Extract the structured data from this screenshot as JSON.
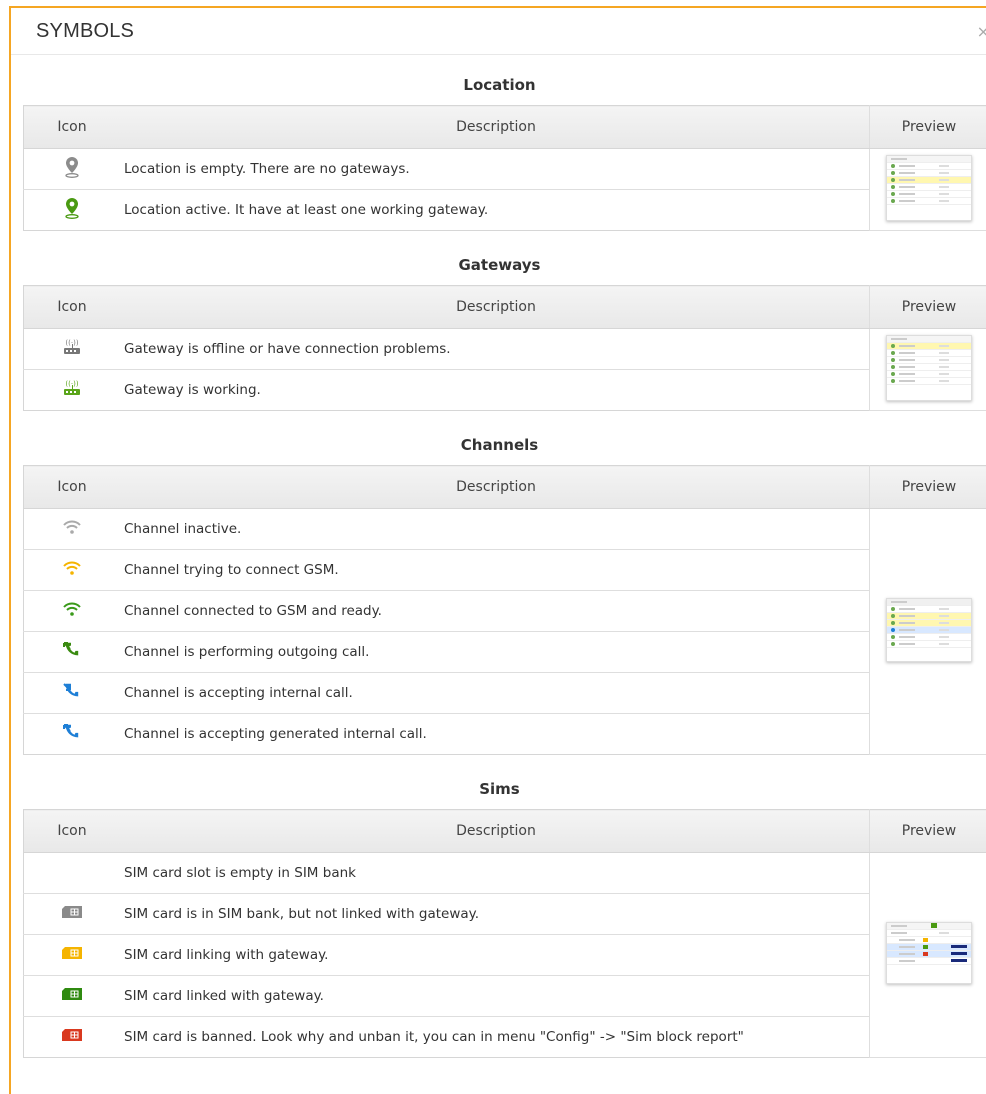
{
  "dialog": {
    "title": "SYMBOLS",
    "close": "×"
  },
  "columns": {
    "icon": "Icon",
    "description": "Description",
    "preview": "Preview"
  },
  "sections": {
    "location": {
      "title": "Location",
      "rows": [
        {
          "icon": "location-pin-gray-icon",
          "description": "Location is empty. There are no gateways."
        },
        {
          "icon": "location-pin-green-icon",
          "description": "Location active. It have at least one working gateway."
        }
      ]
    },
    "gateways": {
      "title": "Gateways",
      "rows": [
        {
          "icon": "gateway-gray-icon",
          "description": "Gateway is offline or have connection problems."
        },
        {
          "icon": "gateway-green-icon",
          "description": "Gateway is working."
        }
      ]
    },
    "channels": {
      "title": "Channels",
      "rows": [
        {
          "icon": "wifi-gray-icon",
          "description": "Channel inactive."
        },
        {
          "icon": "wifi-orange-icon",
          "description": "Channel trying to connect GSM."
        },
        {
          "icon": "wifi-green-icon",
          "description": "Channel connected to GSM and ready."
        },
        {
          "icon": "phone-outgoing-green-icon",
          "description": "Channel is performing outgoing call."
        },
        {
          "icon": "phone-incoming-blue-icon",
          "description": "Channel is accepting internal call."
        },
        {
          "icon": "phone-generated-blue-icon",
          "description": "Channel is accepting generated internal call."
        }
      ]
    },
    "sims": {
      "title": "Sims",
      "rows": [
        {
          "icon": "",
          "description": "SIM card slot is empty in SIM bank"
        },
        {
          "icon": "sim-gray-icon",
          "description": "SIM card is in SIM bank, but not linked with gateway."
        },
        {
          "icon": "sim-orange-icon",
          "description": "SIM card linking with gateway."
        },
        {
          "icon": "sim-green-icon",
          "description": "SIM card linked with gateway."
        },
        {
          "icon": "sim-red-icon",
          "description": "SIM card is banned. Look why and unban it, you can in menu \"Config\" -> \"Sim block report\""
        }
      ]
    }
  },
  "colors": {
    "accent_border": "#f5a623",
    "gray_icon": "#8c8c8c",
    "green_icon": "#4a9a12",
    "orange_icon": "#f5b400",
    "blue_icon": "#1e7fd6",
    "red_icon": "#d9391f"
  }
}
